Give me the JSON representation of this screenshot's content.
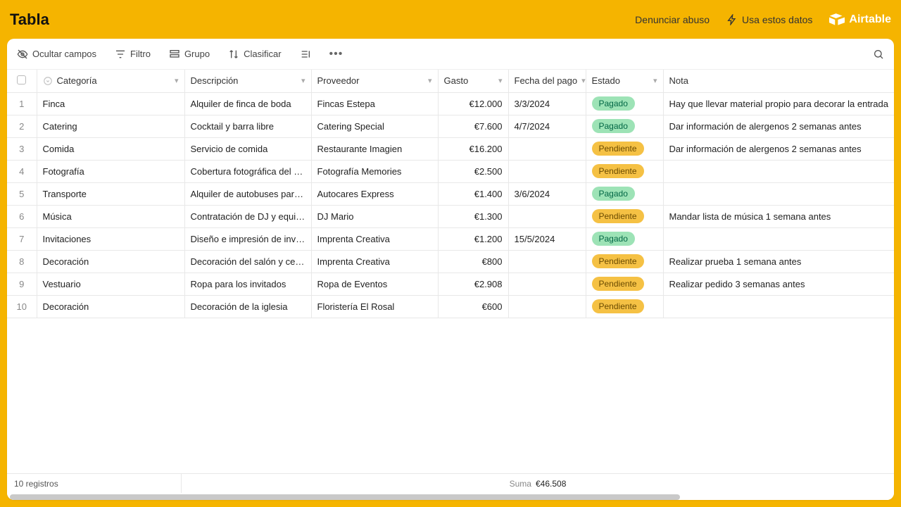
{
  "header": {
    "title": "Tabla",
    "report_abuse": "Denunciar abuso",
    "use_data": "Usa estos datos",
    "brand": "Airtable"
  },
  "toolbar": {
    "hide_fields": "Ocultar campos",
    "filter": "Filtro",
    "group": "Grupo",
    "sort": "Clasificar"
  },
  "columns": {
    "categoria": "Categoría",
    "descripcion": "Descripción",
    "proveedor": "Proveedor",
    "gasto": "Gasto",
    "fecha": "Fecha del pago",
    "estado": "Estado",
    "nota": "Nota"
  },
  "status": {
    "pagado": "Pagado",
    "pendiente": "Pendiente"
  },
  "rows": [
    {
      "n": "1",
      "categoria": "Finca",
      "descripcion": "Alquiler de finca de boda",
      "proveedor": "Fincas Estepa",
      "gasto": "€12.000",
      "fecha": "3/3/2024",
      "estado": "pagado",
      "nota": "Hay que llevar material propio para decorar la entrada"
    },
    {
      "n": "2",
      "categoria": "Catering",
      "descripcion": "Cocktail y barra libre",
      "proveedor": "Catering Special",
      "gasto": "€7.600",
      "fecha": "4/7/2024",
      "estado": "pagado",
      "nota": "Dar información de alergenos 2 semanas antes"
    },
    {
      "n": "3",
      "categoria": "Comida",
      "descripcion": "Servicio de comida",
      "proveedor": "Restaurante Imagien",
      "gasto": "€16.200",
      "fecha": "",
      "estado": "pendiente",
      "nota": "Dar información de alergenos 2 semanas antes"
    },
    {
      "n": "4",
      "categoria": "Fotografía",
      "descripcion": "Cobertura fotográfica del evento",
      "proveedor": "Fotografía Memories",
      "gasto": "€2.500",
      "fecha": "",
      "estado": "pendiente",
      "nota": ""
    },
    {
      "n": "5",
      "categoria": "Transporte",
      "descripcion": "Alquiler de autobuses para invitados",
      "proveedor": "Autocares Express",
      "gasto": "€1.400",
      "fecha": "3/6/2024",
      "estado": "pagado",
      "nota": ""
    },
    {
      "n": "6",
      "categoria": "Música",
      "descripcion": "Contratación de DJ y equipo de sonido",
      "proveedor": "DJ Mario",
      "gasto": "€1.300",
      "fecha": "",
      "estado": "pendiente",
      "nota": "Mandar lista de música 1 semana antes"
    },
    {
      "n": "7",
      "categoria": "Invitaciones",
      "descripcion": "Diseño e impresión de invitaciones",
      "proveedor": "Imprenta Creativa",
      "gasto": "€1.200",
      "fecha": "15/5/2024",
      "estado": "pagado",
      "nota": ""
    },
    {
      "n": "8",
      "categoria": "Decoración",
      "descripcion": "Decoración del salón y ceremonia",
      "proveedor": "Imprenta Creativa",
      "gasto": "€800",
      "fecha": "",
      "estado": "pendiente",
      "nota": "Realizar prueba 1 semana antes"
    },
    {
      "n": "9",
      "categoria": "Vestuario",
      "descripcion": "Ropa para los invitados",
      "proveedor": "Ropa de Eventos",
      "gasto": "€2.908",
      "fecha": "",
      "estado": "pendiente",
      "nota": "Realizar pedido 3 semanas antes"
    },
    {
      "n": "10",
      "categoria": "Decoración",
      "descripcion": "Decoración de la iglesia",
      "proveedor": "Floristería El Rosal",
      "gasto": "€600",
      "fecha": "",
      "estado": "pendiente",
      "nota": ""
    }
  ],
  "footer": {
    "records": "10 registros",
    "sum_label": "Suma",
    "sum_value": "€46.508"
  }
}
